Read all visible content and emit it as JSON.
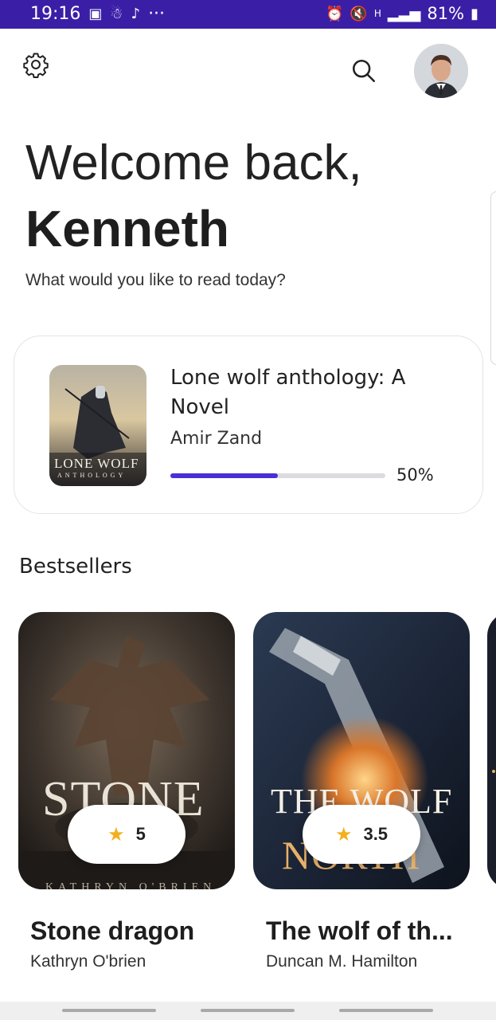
{
  "status_bar": {
    "time": "19:16",
    "more": "···",
    "battery": "81%",
    "network": "H"
  },
  "header": {
    "welcome": "Welcome back,",
    "name": "Kenneth",
    "subtitle": "What would you like to read today?"
  },
  "current_reading": {
    "title": "Lone wolf anthology: A Novel",
    "author": "Amir Zand",
    "progress": 0.5,
    "progress_label": "50%",
    "cover_text": "LONE WOLF",
    "cover_sub": "ANTHOLOGY",
    "progress_color": "#4a2fd6"
  },
  "bestsellers": {
    "title": "Bestsellers",
    "books": [
      {
        "title": "Stone dragon",
        "author": "Kathryn O'brien",
        "rating": "5",
        "cover_text": "STONE",
        "cover_author": "KATHRYN O'BRIEN"
      },
      {
        "title": "The wolf of th...",
        "author": "Duncan M. Hamilton",
        "rating": "3.5",
        "cover_text": "THE WOLF",
        "cover_sub": "NORTH"
      }
    ]
  },
  "colors": {
    "status_bar": "#3a1fa6",
    "accent": "#4a2fd6",
    "star": "#f2b01e"
  }
}
